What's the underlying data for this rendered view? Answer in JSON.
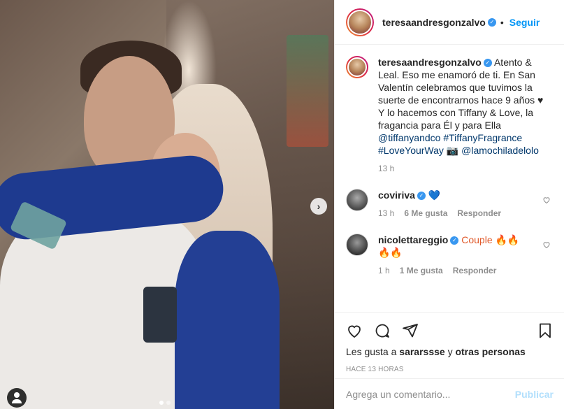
{
  "post": {
    "username": "teresaandresgonzalvo",
    "follow_label": "Seguir",
    "separator": "•"
  },
  "caption": {
    "username": "teresaandresgonzalvo",
    "text_1": " Atento & Leal. Eso me enamoró de ti. En San Valentín celebramos que tuvimos la suerte de encontrarnos hace 9 años ",
    "heart": "♥",
    "text_2": "Y lo hacemos con Tiffany & Love, la fragancia para Él y para Ella ",
    "link_1": "@tiffanyandco",
    "link_2": "#TiffanyFragrance",
    "link_3": "#LoveYourWay",
    "camera": "📷",
    "link_4": "@lamochiladelolo",
    "time": "13 h"
  },
  "comments": [
    {
      "username": "coviriva",
      "text": "💙",
      "time": "13 h",
      "likes": "6 Me gusta",
      "reply": "Responder"
    },
    {
      "username": "nicolettareggio",
      "text": "Couple 🔥🔥 🔥🔥",
      "time": "1 h",
      "likes": "1 Me gusta",
      "reply": "Responder"
    }
  ],
  "likes": {
    "prefix": "Les gusta a ",
    "user": "sararssse",
    "mid": " y ",
    "others": "otras personas"
  },
  "timestamp": "HACE 13 HORAS",
  "add_comment": {
    "placeholder": "Agrega un comentario...",
    "publish_label": "Publicar"
  },
  "carousel": {
    "current": 1,
    "total": 2
  },
  "icons": {
    "next": "chevron-right-icon",
    "like": "heart-icon",
    "comment": "comment-icon",
    "share": "share-icon",
    "save": "bookmark-icon",
    "tag": "user-tag-icon"
  }
}
